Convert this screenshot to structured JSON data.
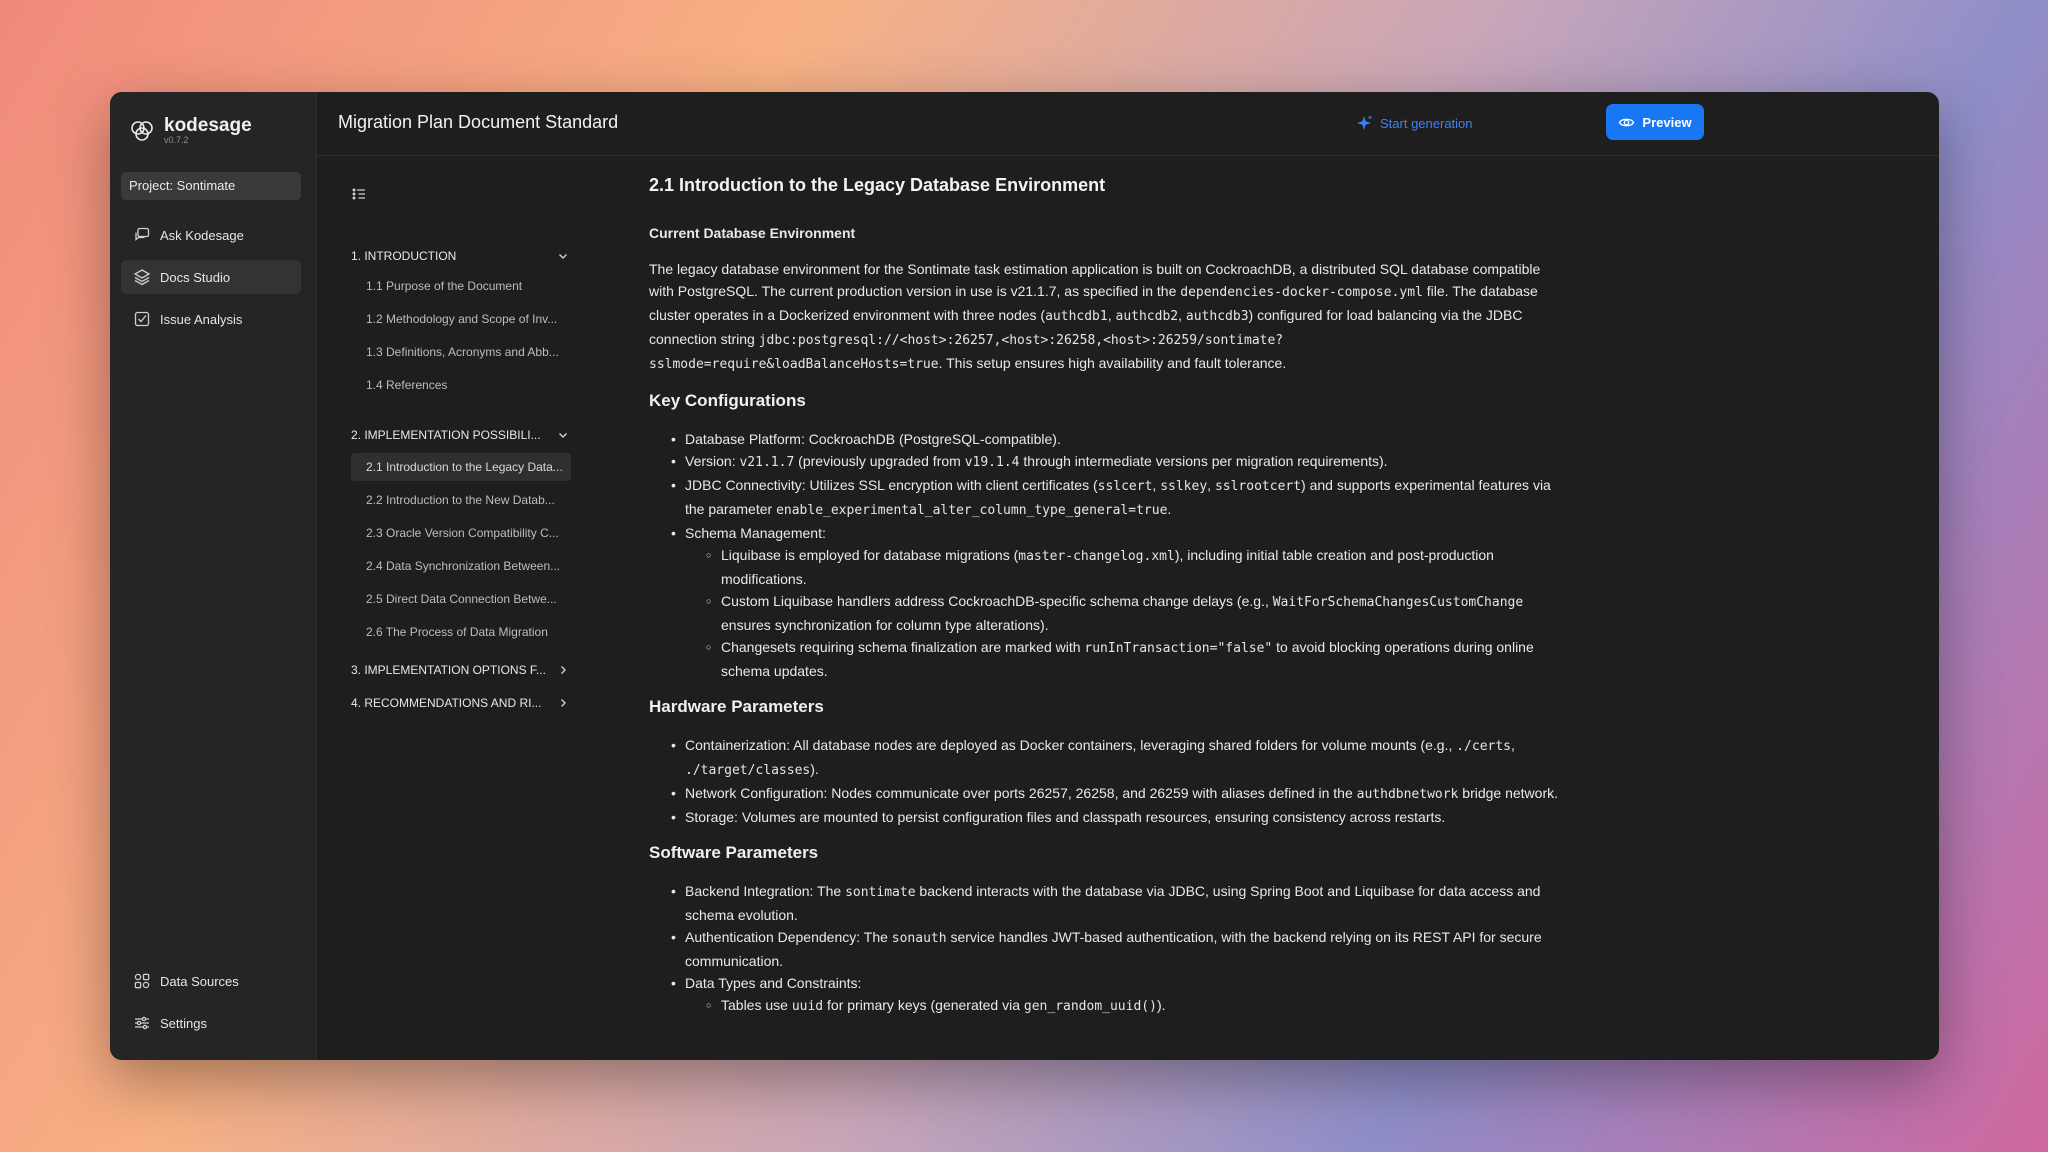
{
  "app": {
    "name": "kodesage",
    "version": "v0.7.2"
  },
  "project": "Project: Sontimate",
  "nav_top": [
    {
      "label": "Ask Kodesage",
      "icon": "chat-icon"
    },
    {
      "label": "Docs Studio",
      "icon": "layers-icon",
      "active": true
    },
    {
      "label": "Issue Analysis",
      "icon": "checkbox-icon"
    }
  ],
  "nav_bottom": [
    {
      "label": "Data Sources",
      "icon": "grid-icon"
    },
    {
      "label": "Settings",
      "icon": "sliders-icon"
    }
  ],
  "header": {
    "title": "Migration Plan Document Standard",
    "start_generation": "Start generation",
    "preview": "Preview"
  },
  "toc": {
    "sections": [
      {
        "label": "1. INTRODUCTION",
        "expanded": true
      },
      {
        "label": "2. IMPLEMENTATION POSSIBILI...",
        "expanded": true
      },
      {
        "label": "3. IMPLEMENTATION OPTIONS F...",
        "expanded": false
      },
      {
        "label": "4. RECOMMENDATIONS AND RI...",
        "expanded": false
      }
    ],
    "items": [
      "1.1 Purpose of the Document",
      "1.2 Methodology and Scope of Inv...",
      "1.3 Definitions, Acronyms and Abb...",
      "1.4 References",
      "2.1 Introduction to the Legacy Data...",
      "2.2 Introduction to the New Datab...",
      "2.3 Oracle Version Compatibility C...",
      "2.4 Data Synchronization Between...",
      "2.5 Direct Data Connection Betwe...",
      "2.6 The Process of Data Migration"
    ]
  },
  "doc": {
    "title": "2.1 Introduction to the Legacy Database Environment",
    "current_env_heading": "Current Database Environment",
    "intro": {
      "t1": "The legacy database environment for the Sontimate task estimation application is built on CockroachDB, a distributed SQL database compatible with PostgreSQL. The current production version in use is v21.1.7, as specified in the ",
      "c1": "dependencies-docker-compose.yml",
      "t2": " file. The database cluster operates in a Dockerized environment with three nodes (",
      "c2": "authcdb1",
      "t3": ", ",
      "c3": "authcdb2",
      "t4": ", ",
      "c4": "authcdb3",
      "t5": ") configured for load balancing via the JDBC connection string ",
      "c5": "jdbc:postgresql://<host>:26257,<host>:26258,<host>:26259/sontimate?sslmode=require&loadBalanceHosts=true",
      "t6": ". This setup ensures high availability and fault tolerance."
    },
    "key_config_heading": "Key Configurations",
    "kc": {
      "platform_label": "Database Platform:",
      "platform_text": " CockroachDB (PostgreSQL-compatible).",
      "version_label": "Version:",
      "version_code": "v21.1.7",
      "version_t1": " (previously upgraded from ",
      "version_code2": "v19.1.4",
      "version_t2": " through intermediate versions per migration requirements).",
      "jdbc_label": "JDBC Connectivity:",
      "jdbc_t1": " Utilizes SSL encryption with client certificates (",
      "jdbc_c1": "sslcert",
      "jdbc_sep1": ", ",
      "jdbc_c2": "sslkey",
      "jdbc_sep2": ", ",
      "jdbc_c3": "sslrootcert",
      "jdbc_t2": ") and supports experimental features via the parameter ",
      "jdbc_c4": "enable_experimental_alter_column_type_general=true",
      "jdbc_t3": ".",
      "schema_label": "Schema Management:",
      "s1_t1": "Liquibase is employed for database migrations (",
      "s1_c1": "master-changelog.xml",
      "s1_t2": "), including initial table creation and post-production modifications.",
      "s2_t1": "Custom Liquibase handlers address CockroachDB-specific schema change delays (e.g., ",
      "s2_c1": "WaitForSchemaChangesCustomChange",
      "s2_t2": " ensures synchronization for column type alterations).",
      "s3_t1": "Changesets requiring schema finalization are marked with ",
      "s3_c1": "runInTransaction=\"false\"",
      "s3_t2": " to avoid blocking operations during online schema updates."
    },
    "hw_heading": "Hardware Parameters",
    "hw": {
      "cont_label": "Containerization:",
      "cont_t1": " All database nodes are deployed as Docker containers, leveraging shared folders for volume mounts (e.g., ",
      "cont_c1": "./certs",
      "cont_sep": ", ",
      "cont_c2": "./target/classes",
      "cont_t2": ").",
      "net_label": "Network Configuration:",
      "net_t1": " Nodes communicate over ports 26257, 26258, and 26259 with aliases defined in the ",
      "net_c1": "authdbnetwork",
      "net_t2": " bridge network.",
      "stor_label": "Storage:",
      "stor_t1": " Volumes are mounted to persist configuration files and classpath resources, ensuring consistency across restarts."
    },
    "sw_heading": "Software Parameters",
    "sw": {
      "be_label": "Backend Integration:",
      "be_t1": " The ",
      "be_c1": "sontimate",
      "be_t2": " backend interacts with the database via JDBC, using Spring Boot and Liquibase for data access and schema evolution.",
      "auth_label": "Authentication Dependency:",
      "auth_t1": " The ",
      "auth_c1": "sonauth",
      "auth_t2": " service handles JWT-based authentication, with the backend relying on its REST API for secure communication.",
      "dt_label": "Data Types and Constraints:",
      "dt1_t1": "Tables use ",
      "dt1_c1": "uuid",
      "dt1_t2": " for primary keys (generated via ",
      "dt1_c2": "gen_random_uuid()",
      "dt1_t3": ")."
    }
  }
}
